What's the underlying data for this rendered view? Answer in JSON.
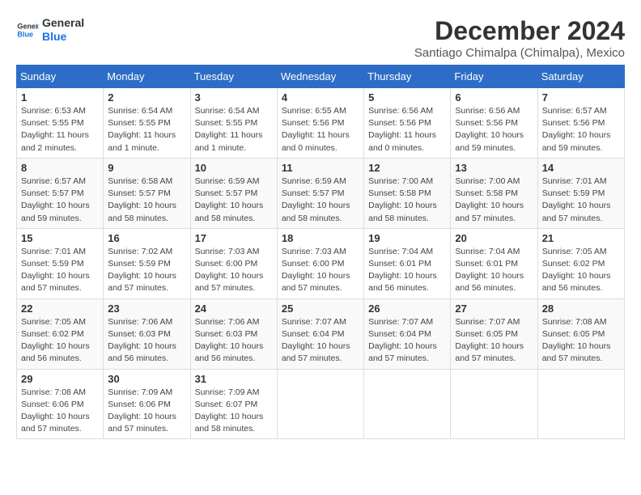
{
  "header": {
    "logo_line1": "General",
    "logo_line2": "Blue",
    "month_year": "December 2024",
    "location": "Santiago Chimalpa (Chimalpa), Mexico"
  },
  "days_of_week": [
    "Sunday",
    "Monday",
    "Tuesday",
    "Wednesday",
    "Thursday",
    "Friday",
    "Saturday"
  ],
  "weeks": [
    [
      {
        "day": "1",
        "sunrise": "6:53 AM",
        "sunset": "5:55 PM",
        "daylight": "11 hours and 2 minutes."
      },
      {
        "day": "2",
        "sunrise": "6:54 AM",
        "sunset": "5:55 PM",
        "daylight": "11 hours and 1 minute."
      },
      {
        "day": "3",
        "sunrise": "6:54 AM",
        "sunset": "5:55 PM",
        "daylight": "11 hours and 1 minute."
      },
      {
        "day": "4",
        "sunrise": "6:55 AM",
        "sunset": "5:56 PM",
        "daylight": "11 hours and 0 minutes."
      },
      {
        "day": "5",
        "sunrise": "6:56 AM",
        "sunset": "5:56 PM",
        "daylight": "11 hours and 0 minutes."
      },
      {
        "day": "6",
        "sunrise": "6:56 AM",
        "sunset": "5:56 PM",
        "daylight": "10 hours and 59 minutes."
      },
      {
        "day": "7",
        "sunrise": "6:57 AM",
        "sunset": "5:56 PM",
        "daylight": "10 hours and 59 minutes."
      }
    ],
    [
      {
        "day": "8",
        "sunrise": "6:57 AM",
        "sunset": "5:57 PM",
        "daylight": "10 hours and 59 minutes."
      },
      {
        "day": "9",
        "sunrise": "6:58 AM",
        "sunset": "5:57 PM",
        "daylight": "10 hours and 58 minutes."
      },
      {
        "day": "10",
        "sunrise": "6:59 AM",
        "sunset": "5:57 PM",
        "daylight": "10 hours and 58 minutes."
      },
      {
        "day": "11",
        "sunrise": "6:59 AM",
        "sunset": "5:57 PM",
        "daylight": "10 hours and 58 minutes."
      },
      {
        "day": "12",
        "sunrise": "7:00 AM",
        "sunset": "5:58 PM",
        "daylight": "10 hours and 58 minutes."
      },
      {
        "day": "13",
        "sunrise": "7:00 AM",
        "sunset": "5:58 PM",
        "daylight": "10 hours and 57 minutes."
      },
      {
        "day": "14",
        "sunrise": "7:01 AM",
        "sunset": "5:59 PM",
        "daylight": "10 hours and 57 minutes."
      }
    ],
    [
      {
        "day": "15",
        "sunrise": "7:01 AM",
        "sunset": "5:59 PM",
        "daylight": "10 hours and 57 minutes."
      },
      {
        "day": "16",
        "sunrise": "7:02 AM",
        "sunset": "5:59 PM",
        "daylight": "10 hours and 57 minutes."
      },
      {
        "day": "17",
        "sunrise": "7:03 AM",
        "sunset": "6:00 PM",
        "daylight": "10 hours and 57 minutes."
      },
      {
        "day": "18",
        "sunrise": "7:03 AM",
        "sunset": "6:00 PM",
        "daylight": "10 hours and 57 minutes."
      },
      {
        "day": "19",
        "sunrise": "7:04 AM",
        "sunset": "6:01 PM",
        "daylight": "10 hours and 56 minutes."
      },
      {
        "day": "20",
        "sunrise": "7:04 AM",
        "sunset": "6:01 PM",
        "daylight": "10 hours and 56 minutes."
      },
      {
        "day": "21",
        "sunrise": "7:05 AM",
        "sunset": "6:02 PM",
        "daylight": "10 hours and 56 minutes."
      }
    ],
    [
      {
        "day": "22",
        "sunrise": "7:05 AM",
        "sunset": "6:02 PM",
        "daylight": "10 hours and 56 minutes."
      },
      {
        "day": "23",
        "sunrise": "7:06 AM",
        "sunset": "6:03 PM",
        "daylight": "10 hours and 56 minutes."
      },
      {
        "day": "24",
        "sunrise": "7:06 AM",
        "sunset": "6:03 PM",
        "daylight": "10 hours and 56 minutes."
      },
      {
        "day": "25",
        "sunrise": "7:07 AM",
        "sunset": "6:04 PM",
        "daylight": "10 hours and 57 minutes."
      },
      {
        "day": "26",
        "sunrise": "7:07 AM",
        "sunset": "6:04 PM",
        "daylight": "10 hours and 57 minutes."
      },
      {
        "day": "27",
        "sunrise": "7:07 AM",
        "sunset": "6:05 PM",
        "daylight": "10 hours and 57 minutes."
      },
      {
        "day": "28",
        "sunrise": "7:08 AM",
        "sunset": "6:05 PM",
        "daylight": "10 hours and 57 minutes."
      }
    ],
    [
      {
        "day": "29",
        "sunrise": "7:08 AM",
        "sunset": "6:06 PM",
        "daylight": "10 hours and 57 minutes."
      },
      {
        "day": "30",
        "sunrise": "7:09 AM",
        "sunset": "6:06 PM",
        "daylight": "10 hours and 57 minutes."
      },
      {
        "day": "31",
        "sunrise": "7:09 AM",
        "sunset": "6:07 PM",
        "daylight": "10 hours and 58 minutes."
      },
      null,
      null,
      null,
      null
    ]
  ],
  "labels": {
    "sunrise": "Sunrise:",
    "sunset": "Sunset:",
    "daylight": "Daylight:"
  }
}
